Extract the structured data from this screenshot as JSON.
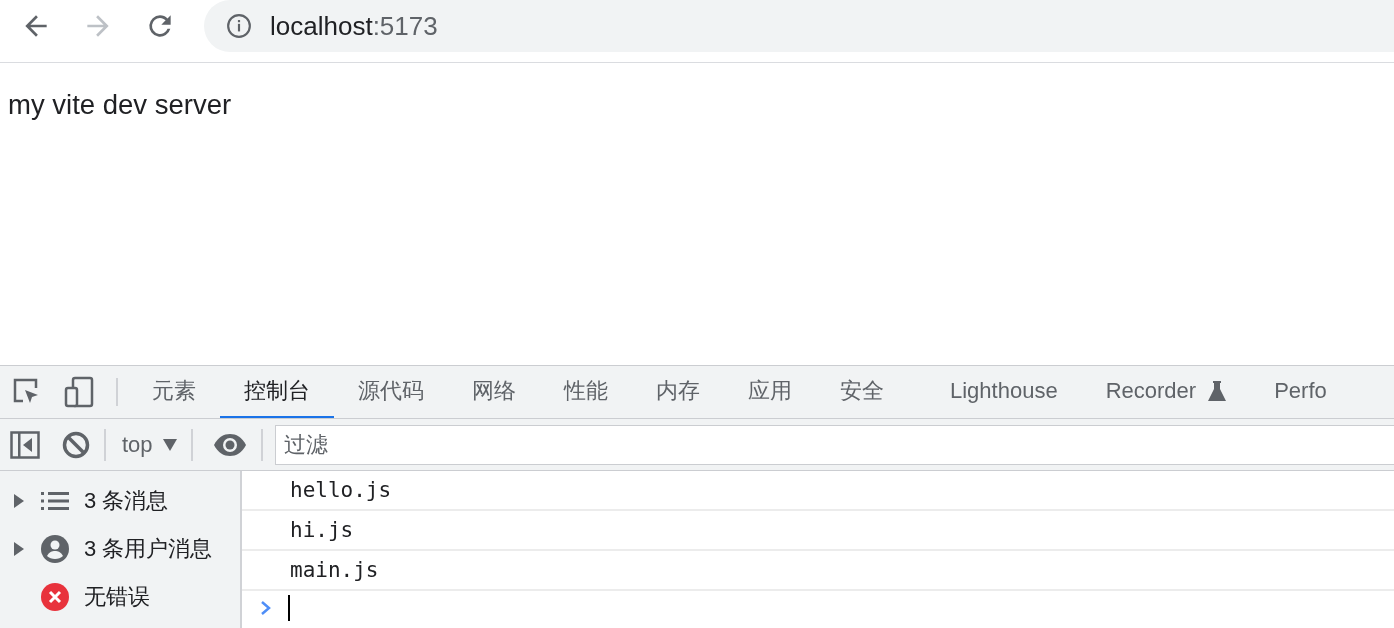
{
  "browser": {
    "address": {
      "host": "localhost",
      "port": ":5173"
    }
  },
  "page": {
    "text": "my vite dev server"
  },
  "devtools": {
    "tabs": [
      {
        "label": "元素",
        "selected": false,
        "kind": "plain"
      },
      {
        "label": "控制台",
        "selected": true,
        "kind": "plain"
      },
      {
        "label": "源代码",
        "selected": false,
        "kind": "plain"
      },
      {
        "label": "网络",
        "selected": false,
        "kind": "plain"
      },
      {
        "label": "性能",
        "selected": false,
        "kind": "plain"
      },
      {
        "label": "内存",
        "selected": false,
        "kind": "plain"
      },
      {
        "label": "应用",
        "selected": false,
        "kind": "plain"
      },
      {
        "label": "安全",
        "selected": false,
        "kind": "plain"
      },
      {
        "label": "Lighthouse",
        "selected": false,
        "kind": "plain"
      },
      {
        "label": "Recorder",
        "selected": false,
        "kind": "experimental"
      },
      {
        "label": "Perfo",
        "selected": false,
        "kind": "plain"
      }
    ],
    "toolbar": {
      "context": "top",
      "filter": {
        "placeholder": "过滤"
      }
    },
    "sidebar": [
      {
        "kind": "messages",
        "label": "3 条消息"
      },
      {
        "kind": "user",
        "label": "3 条用户消息"
      },
      {
        "kind": "error",
        "label": "无错误"
      }
    ],
    "log": [
      "hello.js",
      "hi.js",
      "main.js"
    ]
  }
}
